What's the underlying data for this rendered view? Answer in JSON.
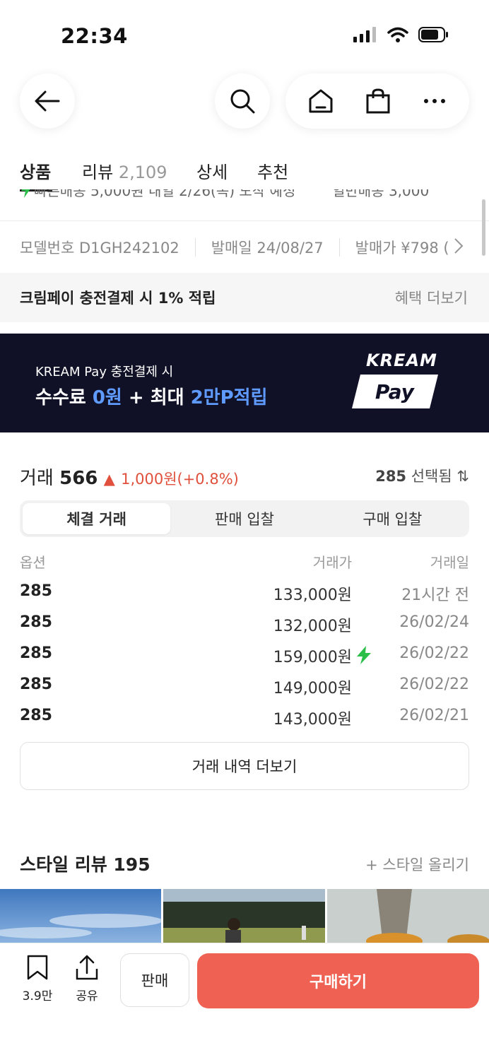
{
  "status": {
    "time": "22:34"
  },
  "tabs": [
    {
      "label": "상품"
    },
    {
      "label": "리뷰",
      "count": "2,109"
    },
    {
      "label": "상세"
    },
    {
      "label": "추천"
    }
  ],
  "cut_row": {
    "left": "빠른배송 5,000원 내일 2/26(목) 도착 예정",
    "right": "일반배송 3,000"
  },
  "spec": {
    "model": "모델번호 D1GH242102",
    "release": "발매일 24/08/27",
    "price": "발매가 ¥798 ("
  },
  "benefit": {
    "text": "크림페이 충전결제 시 1% 적립",
    "more": "혜택 더보기"
  },
  "banner": {
    "sub": "KREAM Pay 충전결제 시",
    "main_a": "수수료 ",
    "main_b": "0원",
    "main_c": " + 최대 ",
    "main_d": "2만P적립",
    "logo_top": "KREAM",
    "logo_pay": "Pay"
  },
  "trade": {
    "label": "거래",
    "count": "566",
    "arrow": "▲",
    "change": "1,000원(+0.8%)",
    "size": "285",
    "selected": "선택됨",
    "sort_icon": "⇅",
    "segments": [
      "체결 거래",
      "판매 입찰",
      "구매 입찰"
    ],
    "headers": {
      "option": "옵션",
      "price": "거래가",
      "date": "거래일"
    },
    "rows": [
      {
        "option": "285",
        "price": "133,000원",
        "date": "21시간 전"
      },
      {
        "option": "285",
        "price": "132,000원",
        "date": "26/02/24"
      },
      {
        "option": "285",
        "price": "159,000원",
        "date": "26/02/22"
      },
      {
        "option": "285",
        "price": "149,000원",
        "date": "26/02/22"
      },
      {
        "option": "285",
        "price": "143,000원",
        "date": "26/02/21"
      }
    ],
    "more": "거래 내역 더보기"
  },
  "style_review": {
    "title": "스타일 리뷰 195",
    "add": "+ 스타일 올리기"
  },
  "bottom": {
    "bookmark_count": "3.9만",
    "share": "공유",
    "sell": "판매",
    "buy": "구매하기"
  },
  "colors": {
    "accent": "#ef6253",
    "up": "#e0503c",
    "banner_bg": "#101126",
    "banner_highlight": "#5f9bff",
    "fast_delivery": "#2bbf4a"
  }
}
